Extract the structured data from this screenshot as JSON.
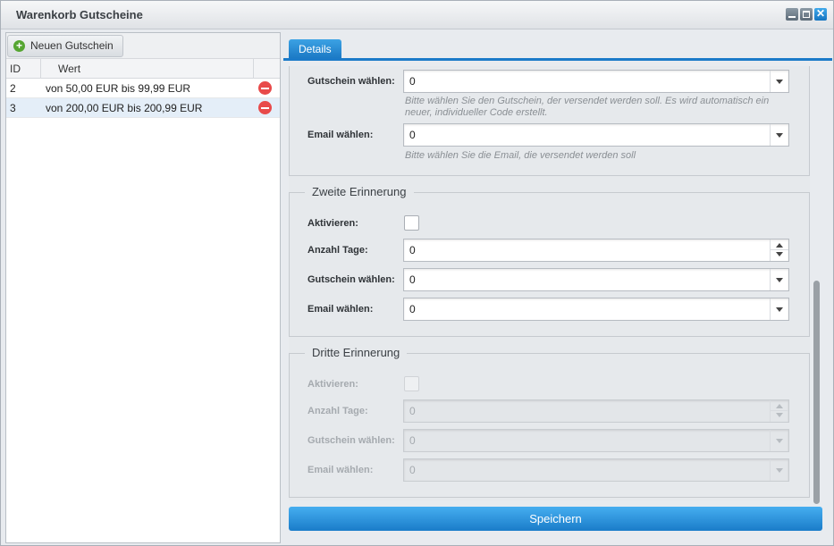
{
  "window": {
    "title": "Warenkorb Gutscheine"
  },
  "left": {
    "new_button": "Neuen Gutschein",
    "columns": [
      "ID",
      "Wert"
    ],
    "rows": [
      {
        "id": "2",
        "wert": "von 50,00 EUR bis 99,99 EUR"
      },
      {
        "id": "3",
        "wert": "von 200,00 EUR bis 200,99 EUR"
      }
    ]
  },
  "tabs": [
    "Details"
  ],
  "first": {
    "gutschein_label": "Gutschein wählen:",
    "gutschein_value": "0",
    "gutschein_hint": "Bitte wählen Sie den Gutschein, der versendet werden soll. Es wird automatisch ein neuer, individueller Code erstellt.",
    "email_label": "Email wählen:",
    "email_value": "0",
    "email_hint": "Bitte wählen Sie die Email, die versendet werden soll"
  },
  "second": {
    "legend": "Zweite Erinnerung",
    "aktivieren_label": "Aktivieren:",
    "tage_label": "Anzahl Tage:",
    "tage_value": "0",
    "gutschein_label": "Gutschein wählen:",
    "gutschein_value": "0",
    "email_label": "Email wählen:",
    "email_value": "0"
  },
  "third": {
    "legend": "Dritte Erinnerung",
    "aktivieren_label": "Aktivieren:",
    "tage_label": "Anzahl Tage:",
    "tage_value": "0",
    "gutschein_label": "Gutschein wählen:",
    "gutschein_value": "0",
    "email_label": "Email wählen:",
    "email_value": "0"
  },
  "save_button": "Speichern"
}
